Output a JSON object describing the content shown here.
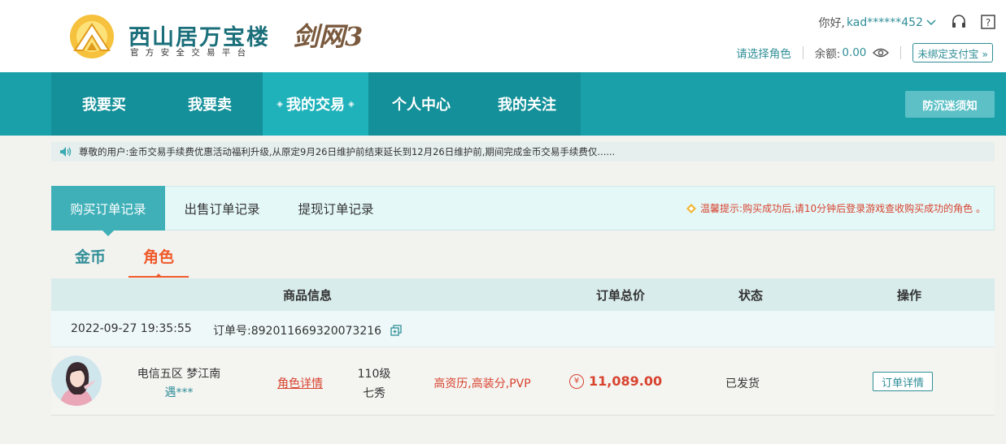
{
  "brand": {
    "title": "西山居万宝楼",
    "subtitle": "官方安全交易平台",
    "game": "剑网3"
  },
  "user": {
    "greeting": "你好,",
    "account": "kad******452",
    "select_role": "请选择角色",
    "balance_label": "余额:",
    "balance": "0.00",
    "alipay": "未绑定支付宝 »"
  },
  "nav": {
    "items": [
      "我要买",
      "我要卖",
      "我的交易",
      "个人中心",
      "我的关注"
    ],
    "active_index": 2,
    "addiction_notice": "防沉迷须知"
  },
  "notice": {
    "text": "尊敬的用户:金币交易手续费优惠活动福利升级,从原定9月26日维护前结束延长到12月26日维护前,期间完成金币交易手续费仅......"
  },
  "tabs": {
    "items": [
      "购买订单记录",
      "出售订单记录",
      "提现订单记录"
    ],
    "active_index": 0,
    "tip": "温馨提示:购买成功后,请10分钟后登录游戏查收购买成功的角色 。"
  },
  "subtabs": {
    "items": [
      "金币",
      "角色"
    ],
    "active_index": 1
  },
  "table": {
    "headers": [
      "商品信息",
      "订单总价",
      "状态",
      "操作"
    ],
    "orders": [
      {
        "time": "2022-09-27 19:35:55",
        "order_label": "订单号:",
        "order_no": "892011669320073216",
        "server": "电信五区 梦江南",
        "role_name": "遇***",
        "role_detail": "角色详情",
        "level": "110级",
        "school": "七秀",
        "tags": "高资历,高装分,PVP",
        "currency_symbol": "¥",
        "price": "11,089.00",
        "status": "已发货",
        "action": "订单详情"
      }
    ]
  },
  "colors": {
    "primary": "#1aa0a8",
    "nav_dark": "#139099",
    "accent_red": "#d8432f",
    "accent_orange": "#f05a2a"
  }
}
